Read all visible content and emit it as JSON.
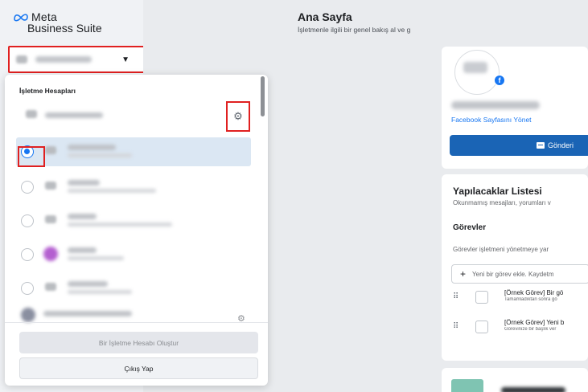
{
  "brand": {
    "line1": "Meta",
    "line2": "Business Suite",
    "icon": "meta-infinity-logo"
  },
  "account_switcher": {
    "caret_icon": "caret-down-icon"
  },
  "main": {
    "title": "Ana Sayfa",
    "subtitle": "İşletmenle ilgili bir genel bakış al ve g"
  },
  "page_card": {
    "manage_link": "Facebook Sayfasını Yönet",
    "send_button": "Gönderi",
    "badge_icon": "facebook-icon"
  },
  "todo": {
    "title": "Yapılacaklar Listesi",
    "subtitle": "Okunmamış mesajları, yorumları v",
    "tasks_heading": "Görevler",
    "tasks_desc": "Görevler işletmeni yönetmeye yar",
    "add_placeholder": "Yeni bir görev ekle. Kaydetm",
    "items": [
      {
        "title": "[Örnek Görev] Bir gö",
        "note": "Tamamladıktan sonra gö"
      },
      {
        "title": "[Örnek Görev] Yeni b",
        "note": "Görevinize bir başlık ver"
      }
    ]
  },
  "dropdown": {
    "title": "İşletme Hesapları",
    "create_button": "Bir İşletme Hesabı Oluştur",
    "logout_button": "Çıkış Yap",
    "settings_icon": "gear-icon"
  },
  "colors": {
    "accent": "#1877f2",
    "highlight": "#e02020",
    "selected_row": "#dbe7f3"
  }
}
